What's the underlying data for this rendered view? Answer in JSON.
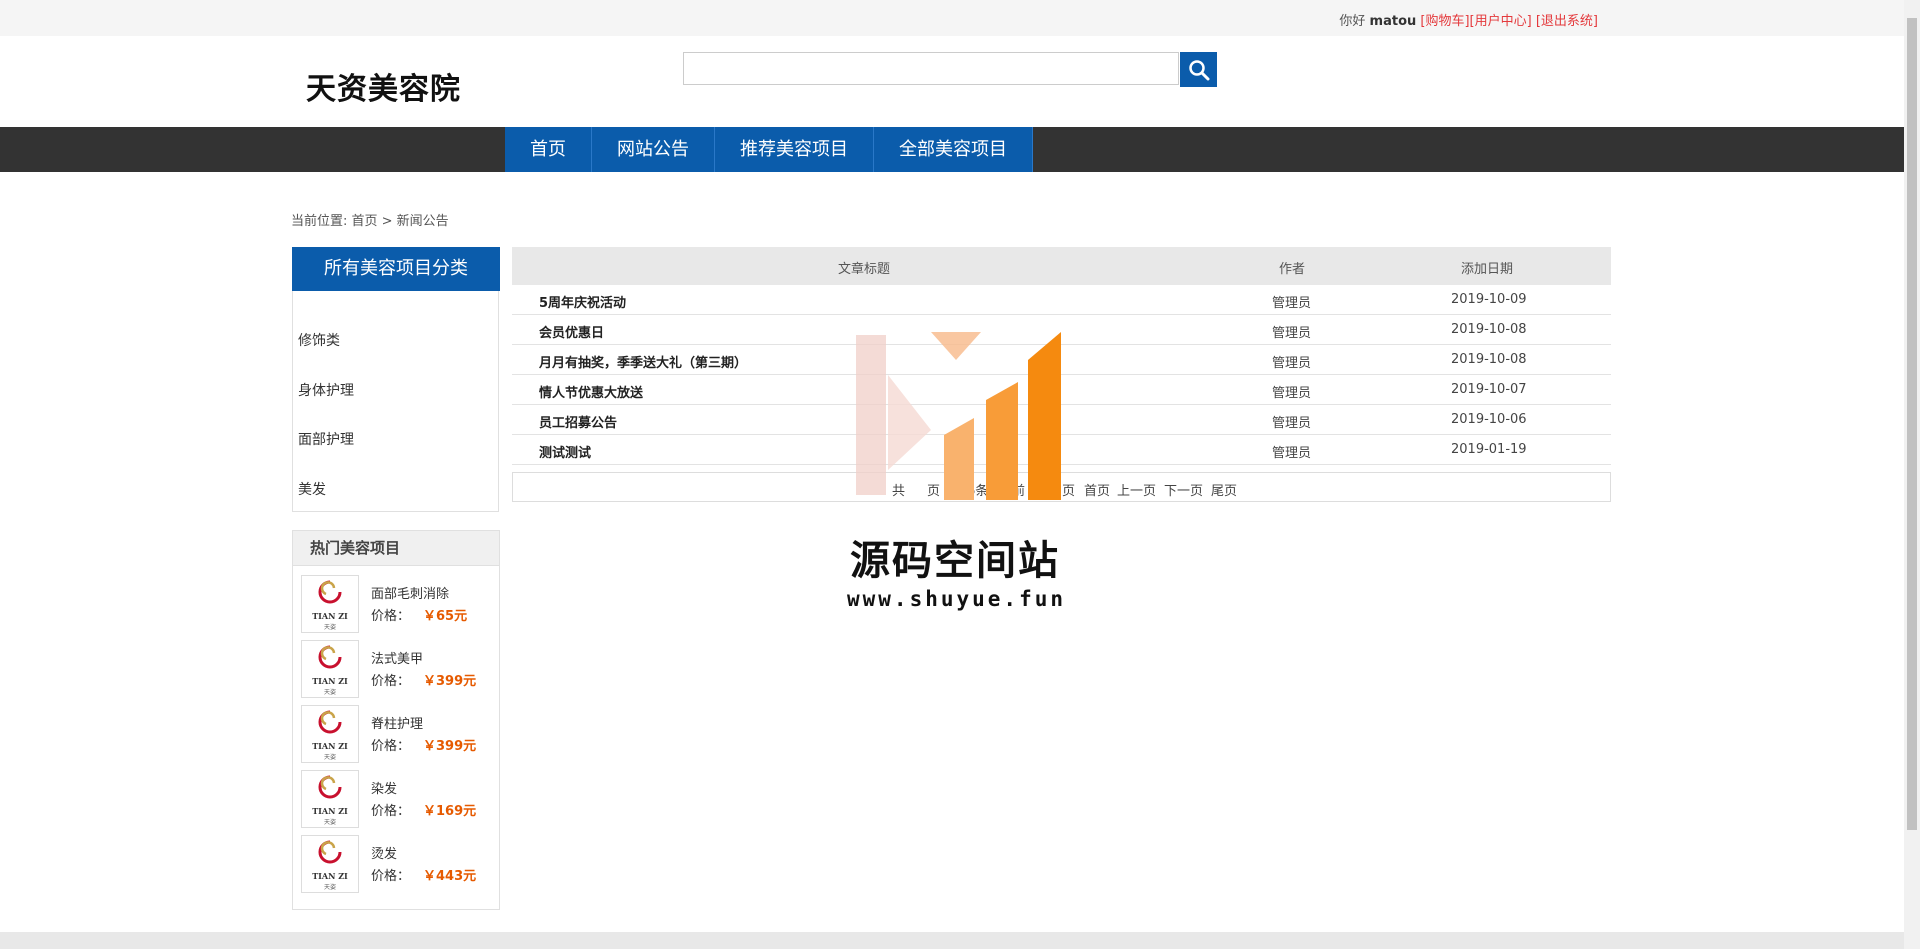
{
  "topbar": {
    "greeting": "你好",
    "username": "matou",
    "cart": "[购物车]",
    "user_center": "[用户中心]",
    "logout": "[退出系统]"
  },
  "header": {
    "logo": "天资美容院",
    "search_placeholder": ""
  },
  "nav": {
    "items": [
      "首页",
      "网站公告",
      "推荐美容项目",
      "全部美容项目"
    ]
  },
  "breadcrumb": "当前位置: 首页 > 新闻公告",
  "sidebar": {
    "title": "所有美容项目分类",
    "categories": [
      "修饰类",
      "身体护理",
      "面部护理",
      "美发"
    ],
    "hot_title": "热门美容项目",
    "price_label": "价格：",
    "thumb_text": "TIAN ZI",
    "thumb_sub": "天姿",
    "hot_items": [
      {
        "name": "面部毛刺消除",
        "price": "￥65元"
      },
      {
        "name": "法式美甲",
        "price": "￥399元"
      },
      {
        "name": "脊柱护理",
        "price": "￥399元"
      },
      {
        "name": "染发",
        "price": "￥169元"
      },
      {
        "name": "烫发",
        "price": "￥443元"
      }
    ]
  },
  "table": {
    "headers": {
      "title": "文章标题",
      "author": "作者",
      "date": "添加日期"
    },
    "rows": [
      {
        "title": "5周年庆祝活动",
        "author": "管理员",
        "date": "2019-10-09"
      },
      {
        "title": "会员优惠日",
        "author": "管理员",
        "date": "2019-10-08"
      },
      {
        "title": "月月有抽奖，季季送大礼（第三期）",
        "author": "管理员",
        "date": "2019-10-08"
      },
      {
        "title": "情人节优惠大放送",
        "author": "管理员",
        "date": "2019-10-07"
      },
      {
        "title": "员工招募公告",
        "author": "管理员",
        "date": "2019-10-06"
      },
      {
        "title": "测试测试",
        "author": "管理员",
        "date": "2019-01-19"
      }
    ]
  },
  "pager": {
    "info_start": "共",
    "info_mid": "页",
    "info_count": "6条",
    "info_cur": "前",
    "info_page": "页",
    "first": "首页",
    "prev": "上一页",
    "next": "下一页",
    "last": "尾页"
  },
  "watermark": {
    "title": "源码空间站",
    "url": "www.shuyue.fun"
  },
  "colors": {
    "primary": "#0b5cab",
    "price": "#e65a00",
    "link": "#e4393c",
    "nav_bg": "#333333"
  }
}
